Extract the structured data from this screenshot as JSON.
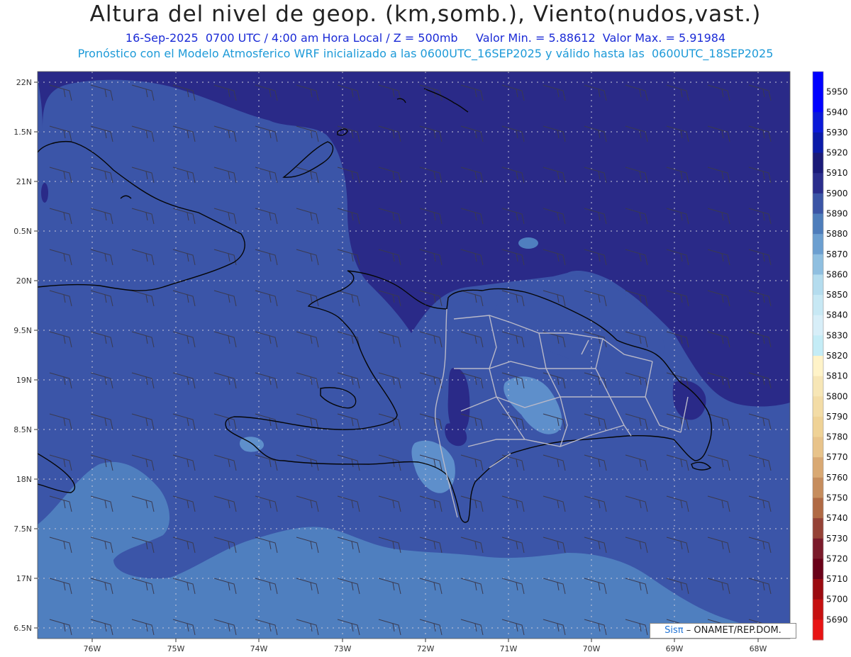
{
  "header": {
    "title": "Altura del nivel de geop. (km,somb.), Viento(nudos,vast.)",
    "subtitle1": "16-Sep-2025  0700 UTC / 4:00 am Hora Local / Z = 500mb     Valor Min. = 5.88612  Valor Max. = 5.91984",
    "subtitle2": "Pronóstico con el Modelo Atmosferico WRF inicializado a las 0600UTC_16SEP2025 y válido hasta las  0600UTC_18SEP2025"
  },
  "axes": {
    "lat_labels": [
      "22N",
      "1.5N",
      "21N",
      "0.5N",
      "20N",
      "9.5N",
      "19N",
      "8.5N",
      "18N",
      "7.5N",
      "17N",
      "6.5N"
    ],
    "lon_labels": [
      "76W",
      "75W",
      "74W",
      "73W",
      "72W",
      "71W",
      "70W",
      "69W",
      "68W"
    ]
  },
  "colorbar": {
    "levels": [
      "5950",
      "5940",
      "5930",
      "5920",
      "5910",
      "5900",
      "5890",
      "5880",
      "5870",
      "5860",
      "5850",
      "5840",
      "5830",
      "5820",
      "5810",
      "5800",
      "5790",
      "5780",
      "5770",
      "5760",
      "5750",
      "5740",
      "5730",
      "5720",
      "5710",
      "5700",
      "5690"
    ],
    "colors": [
      "#0000ff",
      "#0a19d8",
      "#0a1aa8",
      "#1a1a78",
      "#2a2d8c",
      "#3b55a6",
      "#4e7dbb",
      "#6c9fd0",
      "#8fbfe0",
      "#b4dcee",
      "#c7e8f4",
      "#d7eef8",
      "#c4ecf6",
      "#fff3c8",
      "#f7e6b6",
      "#f3dca6",
      "#efd296",
      "#e8c38a",
      "#d9a973",
      "#c68d5d",
      "#b06a44",
      "#954236",
      "#7a1a2a",
      "#6a0018",
      "#9b0a10",
      "#c61010",
      "#e81414"
    ],
    "top_color": "#0000ff",
    "bottom_color": "#ff1a1a"
  },
  "map": {
    "field_colors": {
      "deep": "#2a2a88",
      "mid": "#3b55a8",
      "light": "#4f7fbf",
      "lighter": "#5e8fcb"
    }
  },
  "credit": {
    "brand": "Sisπ",
    "text": "– ONAMET/REP.DOM."
  }
}
